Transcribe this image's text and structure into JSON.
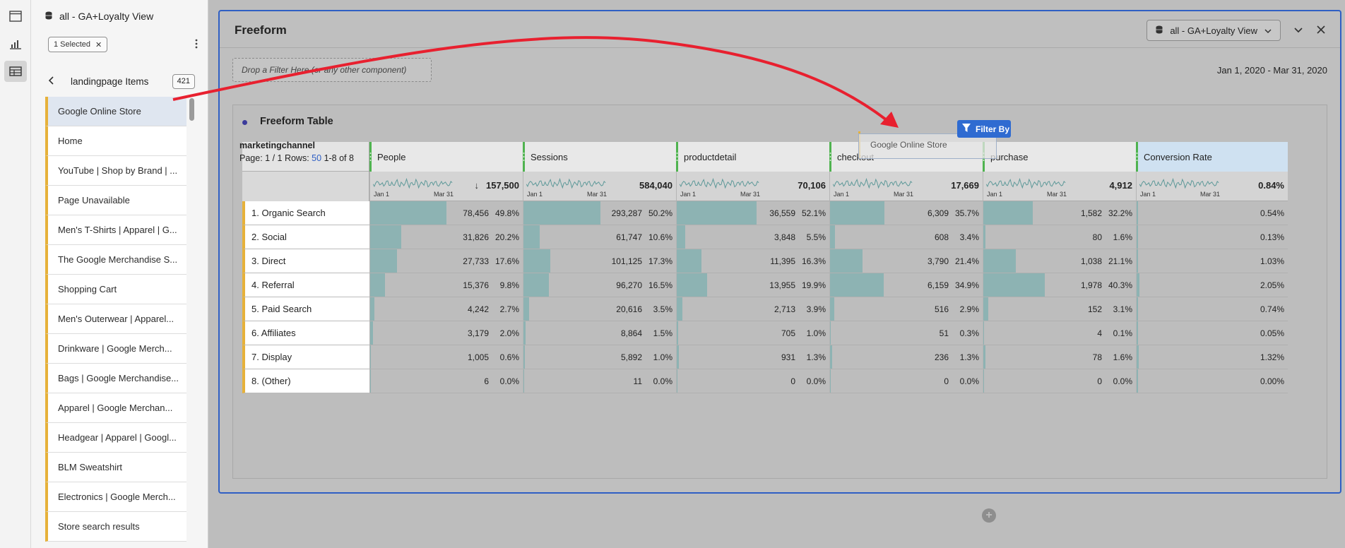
{
  "left_rail": {
    "icons": [
      "panel-icon",
      "visualization-icon",
      "table-components-icon"
    ]
  },
  "components_panel": {
    "data_source": "all - GA+Loyalty View",
    "selected_chip": "1 Selected",
    "breadcrumb": "landingpage Items",
    "item_count": "421",
    "items": [
      "Google Online Store",
      "Home",
      "YouTube | Shop by Brand | ...",
      "Page Unavailable",
      "Men's T-Shirts | Apparel | G...",
      "The Google Merchandise S...",
      "Shopping Cart",
      "Men's Outerwear | Apparel...",
      "Drinkware | Google Merch...",
      "Bags | Google Merchandise...",
      "Apparel | Google Merchan...",
      "Headgear | Apparel | Googl...",
      "BLM Sweatshirt",
      "Electronics | Google Merch...",
      "Store search results"
    ]
  },
  "freeform_panel": {
    "title": "Freeform",
    "data_source": "all - GA+Loyalty View",
    "drop_zone": "Drop a Filter Here (or any other component)",
    "date_range": "Jan 1, 2020 - Mar 31, 2020"
  },
  "table": {
    "title": "Freeform Table",
    "dimension": "marketingchannel",
    "page_label": "Page: 1 / 1",
    "rows_label": "Rows:",
    "rows_value": "50",
    "range_label": "1-8 of 8",
    "date_start": "Jan 1",
    "date_end": "Mar 31",
    "columns": [
      {
        "name": "People",
        "total": "157,500",
        "sorted": true
      },
      {
        "name": "Sessions",
        "total": "584,040"
      },
      {
        "name": "productdetail",
        "total": "70,106"
      },
      {
        "name": "checkout",
        "total": "17,669"
      },
      {
        "name": "purchase",
        "total": "4,912"
      },
      {
        "name": "Conversion Rate",
        "total": "0.84%"
      }
    ],
    "rows": [
      {
        "label": "1. Organic Search",
        "cells": [
          [
            "78,456",
            "49.8%",
            0.498
          ],
          [
            "293,287",
            "50.2%",
            0.502
          ],
          [
            "36,559",
            "52.1%",
            0.521
          ],
          [
            "6,309",
            "35.7%",
            0.357
          ],
          [
            "1,582",
            "32.2%",
            0.322
          ],
          [
            "0.54%",
            "",
            0.0054
          ]
        ]
      },
      {
        "label": "2. Social",
        "cells": [
          [
            "31,826",
            "20.2%",
            0.202
          ],
          [
            "61,747",
            "10.6%",
            0.106
          ],
          [
            "3,848",
            "5.5%",
            0.055
          ],
          [
            "608",
            "3.4%",
            0.034
          ],
          [
            "80",
            "1.6%",
            0.016
          ],
          [
            "0.13%",
            "",
            0.0013
          ]
        ]
      },
      {
        "label": "3. Direct",
        "cells": [
          [
            "27,733",
            "17.6%",
            0.176
          ],
          [
            "101,125",
            "17.3%",
            0.173
          ],
          [
            "11,395",
            "16.3%",
            0.163
          ],
          [
            "3,790",
            "21.4%",
            0.214
          ],
          [
            "1,038",
            "21.1%",
            0.211
          ],
          [
            "1.03%",
            "",
            0.0103
          ]
        ]
      },
      {
        "label": "4. Referral",
        "cells": [
          [
            "15,376",
            "9.8%",
            0.098
          ],
          [
            "96,270",
            "16.5%",
            0.165
          ],
          [
            "13,955",
            "19.9%",
            0.199
          ],
          [
            "6,159",
            "34.9%",
            0.349
          ],
          [
            "1,978",
            "40.3%",
            0.403
          ],
          [
            "2.05%",
            "",
            0.0205
          ]
        ]
      },
      {
        "label": "5. Paid Search",
        "cells": [
          [
            "4,242",
            "2.7%",
            0.027
          ],
          [
            "20,616",
            "3.5%",
            0.035
          ],
          [
            "2,713",
            "3.9%",
            0.039
          ],
          [
            "516",
            "2.9%",
            0.029
          ],
          [
            "152",
            "3.1%",
            0.031
          ],
          [
            "0.74%",
            "",
            0.0074
          ]
        ]
      },
      {
        "label": "6. Affiliates",
        "cells": [
          [
            "3,179",
            "2.0%",
            0.02
          ],
          [
            "8,864",
            "1.5%",
            0.015
          ],
          [
            "705",
            "1.0%",
            0.01
          ],
          [
            "51",
            "0.3%",
            0.003
          ],
          [
            "4",
            "0.1%",
            0.001
          ],
          [
            "0.05%",
            "",
            0.0005
          ]
        ]
      },
      {
        "label": "7. Display",
        "cells": [
          [
            "1,005",
            "0.6%",
            0.006
          ],
          [
            "5,892",
            "1.0%",
            0.01
          ],
          [
            "931",
            "1.3%",
            0.013
          ],
          [
            "236",
            "1.3%",
            0.013
          ],
          [
            "78",
            "1.6%",
            0.016
          ],
          [
            "1.32%",
            "",
            0.0132
          ]
        ]
      },
      {
        "label": "8. (Other)",
        "cells": [
          [
            "6",
            "0.0%",
            0
          ],
          [
            "11",
            "0.0%",
            0
          ],
          [
            "0",
            "0.0%",
            0
          ],
          [
            "0",
            "0.0%",
            0
          ],
          [
            "0",
            "0.0%",
            0
          ],
          [
            "0.00%",
            "",
            0
          ]
        ]
      }
    ]
  },
  "drag_state": {
    "dragged_item": "Google Online Store",
    "filter_button": "Filter By"
  },
  "colors": {
    "accent_blue": "#2f5fc4",
    "annotation_red": "#e8202f",
    "bar_teal": "#8db3b3",
    "dimension_yellow": "#e6b13a",
    "metric_green": "#4fb34f"
  }
}
